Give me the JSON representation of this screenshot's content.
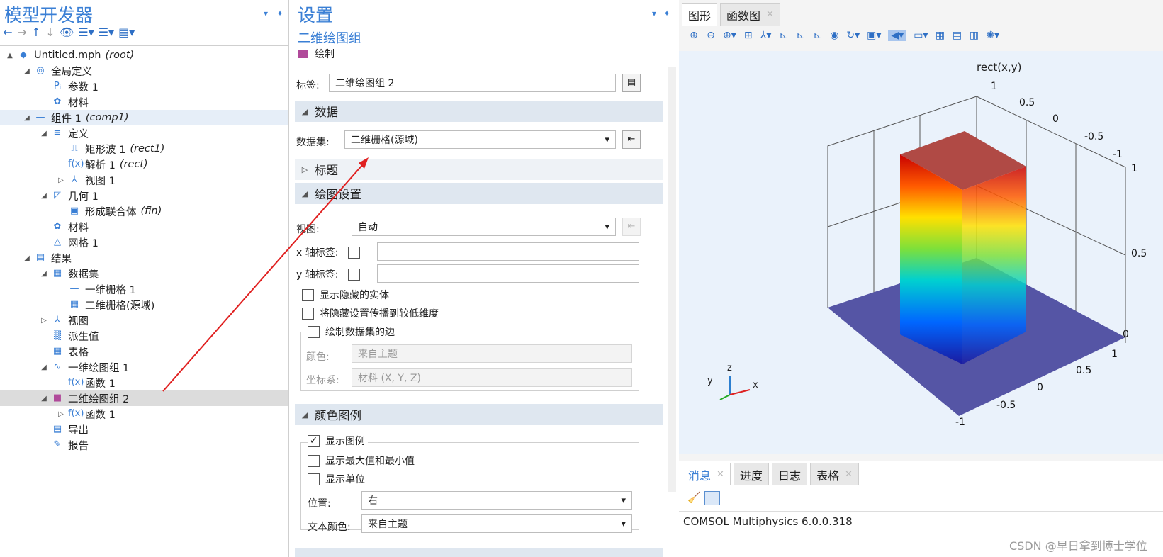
{
  "left": {
    "title": "模型开发器",
    "tree": [
      {
        "label": "Untitled.mph",
        "tag": "(root)",
        "exp": "▲"
      },
      {
        "label": "全局定义",
        "tag": "",
        "exp": "◢"
      },
      {
        "label": "参数 1",
        "tag": "",
        "exp": ""
      },
      {
        "label": "材料",
        "tag": "",
        "exp": ""
      },
      {
        "label": "组件 1",
        "tag": "(comp1)",
        "exp": "◢"
      },
      {
        "label": "定义",
        "tag": "",
        "exp": "◢"
      },
      {
        "label": "矩形波 1",
        "tag": "(rect1)",
        "exp": ""
      },
      {
        "label": "解析 1",
        "tag": "(rect)",
        "exp": ""
      },
      {
        "label": "视图 1",
        "tag": "",
        "exp": "▷"
      },
      {
        "label": "几何 1",
        "tag": "",
        "exp": "◢"
      },
      {
        "label": "形成联合体",
        "tag": "(fin)",
        "exp": ""
      },
      {
        "label": "材料",
        "tag": "",
        "exp": ""
      },
      {
        "label": "网格 1",
        "tag": "",
        "exp": ""
      },
      {
        "label": "结果",
        "tag": "",
        "exp": "◢"
      },
      {
        "label": "数据集",
        "tag": "",
        "exp": "◢"
      },
      {
        "label": "一维栅格 1",
        "tag": "",
        "exp": ""
      },
      {
        "label": "二维栅格(源域)",
        "tag": "",
        "exp": ""
      },
      {
        "label": "视图",
        "tag": "",
        "exp": "▷"
      },
      {
        "label": "派生值",
        "tag": "",
        "exp": ""
      },
      {
        "label": "表格",
        "tag": "",
        "exp": ""
      },
      {
        "label": "一维绘图组 1",
        "tag": "",
        "exp": "◢"
      },
      {
        "label": "函数 1",
        "tag": "",
        "exp": ""
      },
      {
        "label": "二维绘图组 2",
        "tag": "",
        "exp": "◢"
      },
      {
        "label": "函数 1",
        "tag": "",
        "exp": "▷"
      },
      {
        "label": "导出",
        "tag": "",
        "exp": ""
      },
      {
        "label": "报告",
        "tag": "",
        "exp": ""
      }
    ]
  },
  "settings": {
    "title": "设置",
    "subtitle": "二维绘图组",
    "plot_label": "绘制",
    "label_caption": "标签:",
    "label_value": "二维绘图组 2",
    "sec_data": "数据",
    "dataset_caption": "数据集:",
    "dataset_value": "二维栅格(源域)",
    "sec_title": "标题",
    "sec_plot": "绘图设置",
    "view_caption": "视图:",
    "view_value": "自动",
    "xlabel_caption": "x 轴标签:",
    "ylabel_caption": "y 轴标签:",
    "show_hidden": "显示隐藏的实体",
    "propagate": "将隐藏设置传播到较低维度",
    "draw_edges": "绘制数据集的边",
    "color_caption": "颜色:",
    "color_value": "来自主题",
    "coord_caption": "坐标系:",
    "coord_value": "材料  (X, Y, Z)",
    "sec_legend": "颜色图例",
    "show_legend": "显示图例",
    "show_minmax": "显示最大值和最小值",
    "show_units": "显示单位",
    "position_caption": "位置:",
    "position_value": "右",
    "textcolor_caption": "文本颜色:",
    "textcolor_value": "来自主题"
  },
  "graphics": {
    "tabs": [
      "图形",
      "函数图"
    ],
    "plot_title": "rect(x,y)",
    "ticks": {
      "z_right": [
        "1",
        "0.5",
        "0"
      ],
      "y_back": [
        "1",
        "0.5",
        "0",
        "-0.5",
        "-1"
      ],
      "x_front": [
        "1",
        "0.5",
        "0",
        "-0.5",
        "-1"
      ]
    },
    "axis": {
      "x": "x",
      "y": "y",
      "z": "z"
    }
  },
  "messages": {
    "tabs": [
      "消息",
      "进度",
      "日志",
      "表格"
    ],
    "text": "COMSOL Multiphysics 6.0.0.318"
  },
  "watermark": "CSDN @早日拿到博士学位"
}
